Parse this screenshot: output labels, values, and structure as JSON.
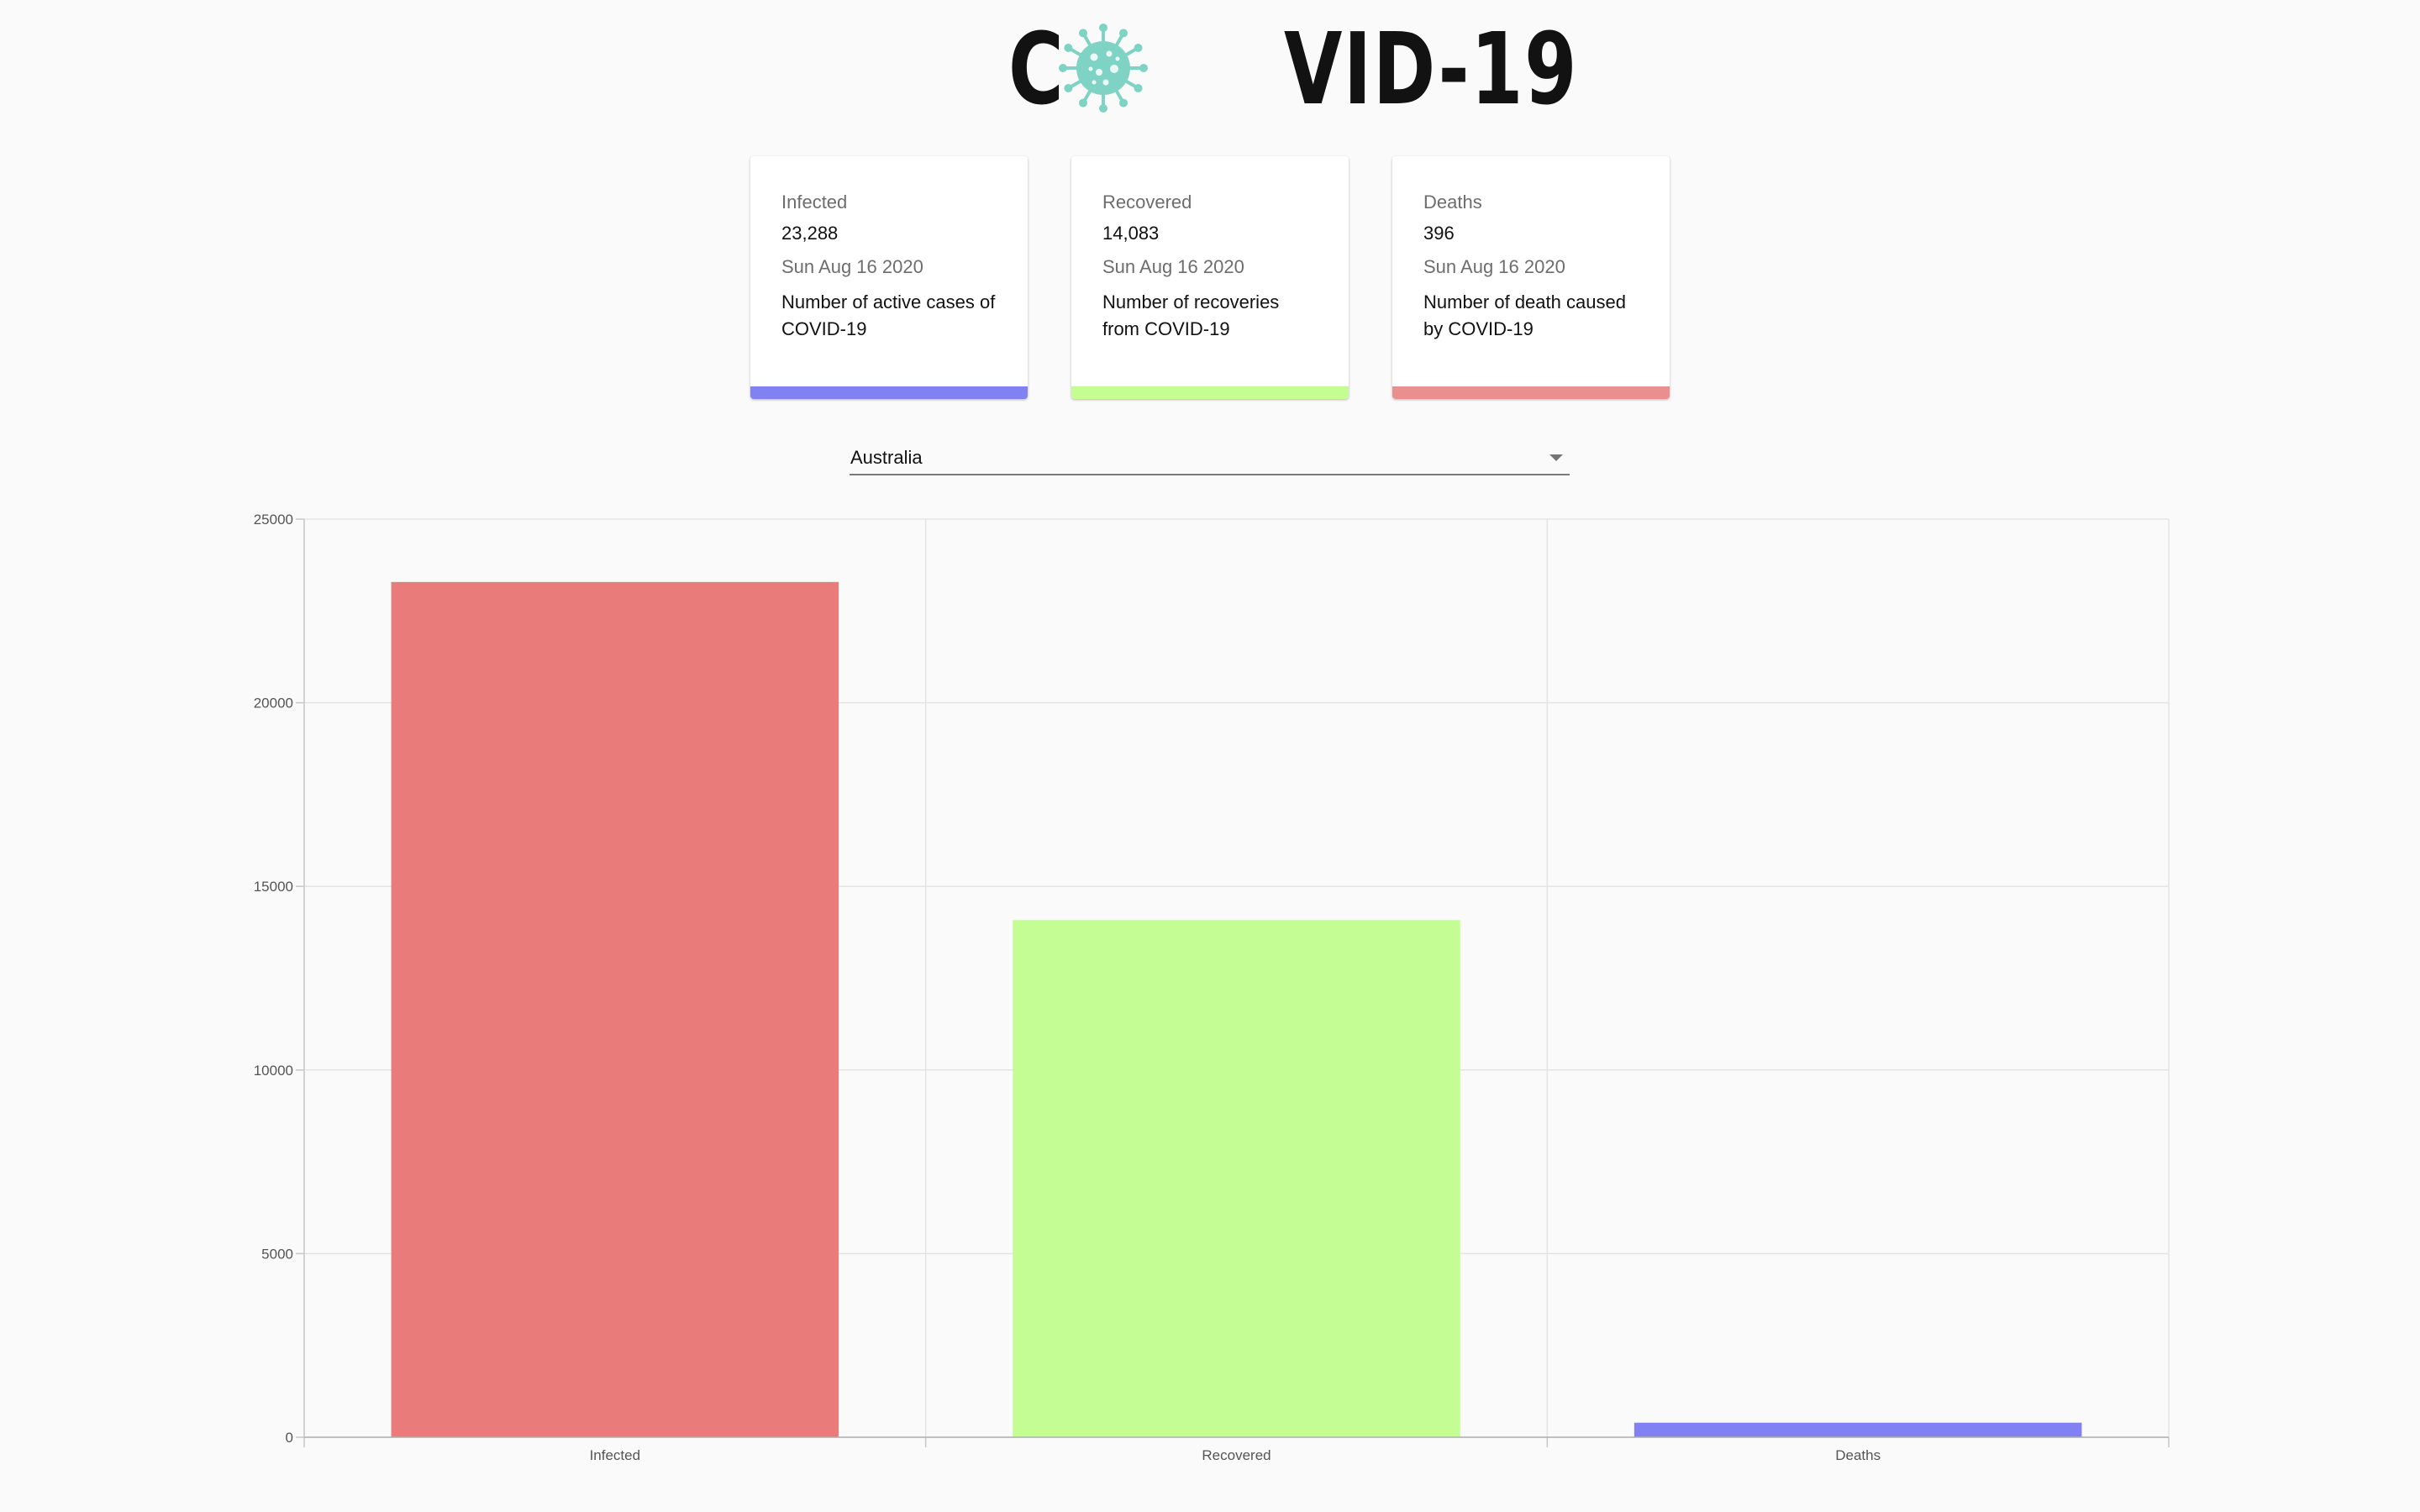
{
  "logo": {
    "text_before": "C",
    "text_after": "VID-19",
    "icon": "virus-icon",
    "icon_color": "#7fd3c4"
  },
  "cards": [
    {
      "title": "Infected",
      "value": "23,288",
      "date": "Sun Aug 16 2020",
      "description": "Number of active cases of COVID-19",
      "bar_color": "#8181f4"
    },
    {
      "title": "Recovered",
      "value": "14,083",
      "date": "Sun Aug 16 2020",
      "description": "Number of recoveries from COVID-19",
      "bar_color": "#c5fd95"
    },
    {
      "title": "Deaths",
      "value": "396",
      "date": "Sun Aug 16 2020",
      "description": "Number of death caused by COVID-19",
      "bar_color": "#e9908e"
    }
  ],
  "country_select": {
    "selected": "Australia",
    "arrow_icon": "dropdown-arrow-icon"
  },
  "chart_data": {
    "type": "bar",
    "categories": [
      "Infected",
      "Recovered",
      "Deaths"
    ],
    "values": [
      23288,
      14083,
      396
    ],
    "colors": [
      "#ea7b7b",
      "#c5fd95",
      "#8181f4"
    ],
    "ylim": [
      0,
      25000
    ],
    "yticks": [
      0,
      5000,
      10000,
      15000,
      20000,
      25000
    ],
    "grid": true,
    "legend": "none"
  }
}
